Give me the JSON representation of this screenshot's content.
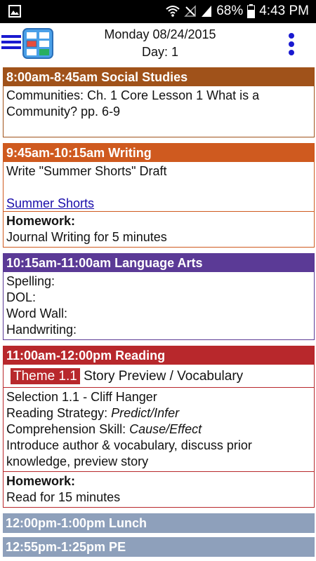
{
  "status_bar": {
    "battery": "68%",
    "time": "4:43 PM",
    "icons": [
      "picture-icon",
      "wifi-icon",
      "no-signal-icon",
      "signal-icon",
      "battery-icon"
    ]
  },
  "app_bar": {
    "date": "Monday 08/24/2015",
    "day": "Day: 1",
    "icons": [
      "hamburger-menu-icon",
      "planner-app-icon",
      "more-vert-icon"
    ]
  },
  "colors": {
    "social_studies": "#a0521a",
    "writing": "#cf5a1f",
    "language_arts": "#5b3a96",
    "reading": "#b8282c",
    "lunch": "#8ea0bb",
    "pe": "#8ea0bb"
  },
  "schedule": {
    "social_studies": {
      "header": "8:00am-8:45am Social Studies",
      "lines": [
        "Communities: Ch. 1 Core Lesson 1 What is a Community? pp. 6-9"
      ]
    },
    "writing": {
      "header": "9:45am-10:15am Writing",
      "line1": "Write \"Summer Shorts\" Draft",
      "link": "Summer Shorts",
      "homework_label": "Homework:",
      "homework_text": "Journal Writing for 5 minutes"
    },
    "language_arts": {
      "header": "10:15am-11:00am Language Arts",
      "lines": [
        "Spelling:",
        "DOL:",
        "Word Wall:",
        "Handwriting:"
      ]
    },
    "reading": {
      "header": "11:00am-12:00pm Reading",
      "theme_badge": "Theme 1.1",
      "theme_text": "Story Preview / Vocabulary",
      "selection": "Selection 1.1 - Cliff Hanger",
      "strategy_label": "Reading Strategy: ",
      "strategy_value": "Predict/Infer",
      "skill_label": "Comprehension Skill: ",
      "skill_value": "Cause/Effect",
      "intro": "Introduce author & vocabulary, discuss prior knowledge, preview story",
      "homework_label": "Homework:",
      "homework_text": "Read for 15 minutes"
    },
    "lunch": {
      "header": "12:00pm-1:00pm Lunch"
    },
    "pe": {
      "header": "12:55pm-1:25pm PE"
    }
  }
}
